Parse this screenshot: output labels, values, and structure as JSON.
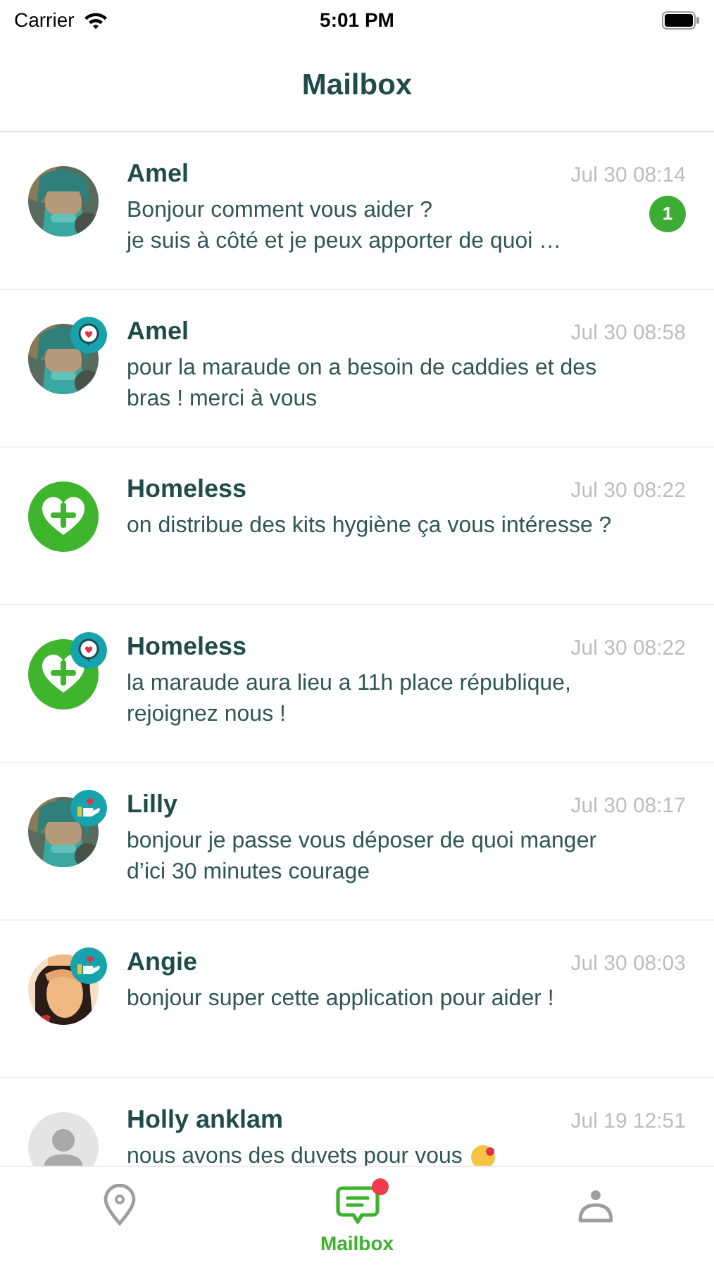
{
  "status_bar": {
    "carrier": "Carrier",
    "time": "5:01 PM"
  },
  "header": {
    "title": "Mailbox"
  },
  "conversations": [
    {
      "name": "Amel",
      "time": "Jul 30 08:14",
      "message": "Bonjour comment vous aider ?\nje suis à côté et je peux apporter de quoi …",
      "unread": "1"
    },
    {
      "name": "Amel",
      "time": "Jul 30 08:58",
      "message": "pour la maraude on a besoin de caddies et des bras ! merci à vous",
      "badge": {
        "kind": "chat"
      }
    },
    {
      "name": "Homeless",
      "time": "Jul 30 08:22",
      "message": "on distribue des kits hygiène ça vous intéresse ?",
      "avatar": {
        "kind": "logo"
      }
    },
    {
      "name": "Homeless",
      "time": "Jul 30 08:22",
      "message": "la maraude aura lieu a 11h place république, rejoignez nous !",
      "avatar": {
        "kind": "logo"
      },
      "badge": {
        "kind": "chat"
      }
    },
    {
      "name": "Lilly",
      "time": "Jul 30 08:17",
      "message": "bonjour je passe vous déposer de quoi manger d’ici 30 minutes   courage",
      "badge": {
        "kind": "hand"
      }
    },
    {
      "name": "Angie",
      "time": "Jul 30 08:03",
      "message": "bonjour super cette application pour aider !",
      "avatar": {
        "kind": "drawing"
      },
      "badge": {
        "kind": "hand"
      }
    },
    {
      "name": "Holly anklam",
      "time": "Jul 19 12:51",
      "message": "nous avons des duvets pour vous",
      "avatar": {
        "kind": "placeholder"
      },
      "emoji": true
    }
  ],
  "tab_bar": [
    {
      "kind": "map",
      "selected": false
    },
    {
      "kind": "mailbox",
      "label": "Mailbox",
      "selected": true,
      "notification": true
    },
    {
      "kind": "profile",
      "selected": false
    }
  ]
}
